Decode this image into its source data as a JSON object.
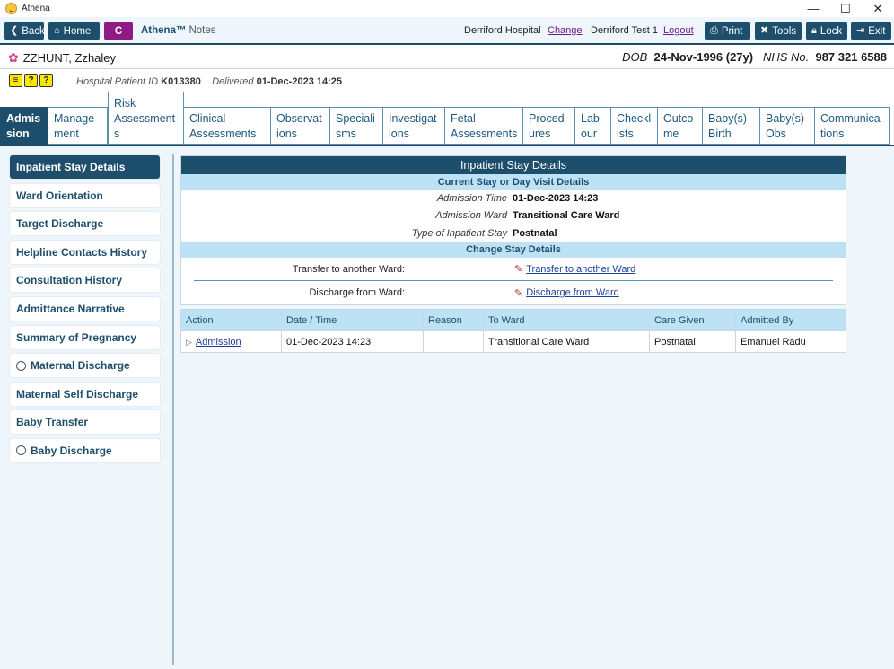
{
  "window": {
    "title": "Athena",
    "minimize": "—",
    "maximize": "☐",
    "close": "✕"
  },
  "toolbar": {
    "back": "Back",
    "home": "Home",
    "c_label": "C",
    "brand": "Athena™",
    "brand_sub": "Notes",
    "hospital": "Derriford Hospital",
    "change": "Change",
    "user": "Derriford Test 1",
    "logout": "Logout",
    "print": "Print",
    "tools": "Tools",
    "lock": "Lock",
    "exit": "Exit"
  },
  "patient": {
    "name": "ZZHUNT, Zzhaley",
    "dob_label": "DOB",
    "dob": "24-Nov-1996 (27y)",
    "nhs_label": "NHS No.",
    "nhs": "987 321 6588",
    "hospital_id_label": "Hospital Patient ID",
    "hospital_id": "K013380",
    "delivered_label": "Delivered",
    "delivered": "01-Dec-2023 14:25"
  },
  "tabs": [
    {
      "label": "Admission",
      "l1": "Admis",
      "l2": "sion"
    },
    {
      "label": "Management",
      "l1": "Manage",
      "l2": "ment"
    },
    {
      "label": "Risk Assessments",
      "l1": "Risk",
      "l2": "Assessment",
      "l3": "s"
    },
    {
      "label": "Clinical Assessments",
      "l1": "Clinical",
      "l2": "Assessments"
    },
    {
      "label": "Observations",
      "l1": "Observat",
      "l2": "ions"
    },
    {
      "label": "Specialisms",
      "l1": "Speciali",
      "l2": "sms"
    },
    {
      "label": "Investigations",
      "l1": "Investigat",
      "l2": "ions"
    },
    {
      "label": "Fetal Assessments",
      "l1": "Fetal",
      "l2": "Assessments"
    },
    {
      "label": "Procedures",
      "l1": "Proced",
      "l2": "ures"
    },
    {
      "label": "Labour",
      "l1": "Lab",
      "l2": "our"
    },
    {
      "label": "Checklists",
      "l1": "Checkl",
      "l2": "ists"
    },
    {
      "label": "Outcome",
      "l1": "Outco",
      "l2": "me"
    },
    {
      "label": "Baby(s) Birth",
      "l1": "Baby(s)",
      "l2": "Birth"
    },
    {
      "label": "Baby(s) Obs",
      "l1": "Baby(s)",
      "l2": "Obs"
    },
    {
      "label": "Communications",
      "l1": "Communica",
      "l2": "tions"
    }
  ],
  "sidebar": {
    "items": [
      {
        "label": "Inpatient Stay Details"
      },
      {
        "label": "Ward Orientation"
      },
      {
        "label": "Target Discharge"
      },
      {
        "label": "Helpline Contacts History"
      },
      {
        "label": "Consultation History"
      },
      {
        "label": "Admittance Narrative"
      },
      {
        "label": "Summary of Pregnancy"
      },
      {
        "label": "Maternal Discharge"
      },
      {
        "label": "Maternal Self Discharge"
      },
      {
        "label": "Baby Transfer"
      },
      {
        "label": "Baby Discharge"
      }
    ]
  },
  "details": {
    "title": "Inpatient Stay Details",
    "current_header": "Current Stay or Day Visit Details",
    "admission_time_label": "Admission Time",
    "admission_time": "01-Dec-2023 14:23",
    "admission_ward_label": "Admission Ward",
    "admission_ward": "Transitional Care Ward",
    "stay_type_label": "Type of Inpatient Stay",
    "stay_type": "Postnatal",
    "change_header": "Change Stay Details",
    "transfer_label": "Transfer to another Ward:",
    "transfer_link": "Transfer to another Ward",
    "discharge_label": "Discharge from Ward:",
    "discharge_link": "Discharge from Ward"
  },
  "table": {
    "headers": [
      "Action",
      "Date / Time",
      "Reason",
      "To Ward",
      "Care Given",
      "Admitted By"
    ],
    "rows": [
      {
        "action": "Admission",
        "datetime": "01-Dec-2023 14:23",
        "reason": "",
        "to_ward": "Transitional Care Ward",
        "care_given": "Postnatal",
        "admitted_by": "Emanuel Radu"
      }
    ]
  }
}
